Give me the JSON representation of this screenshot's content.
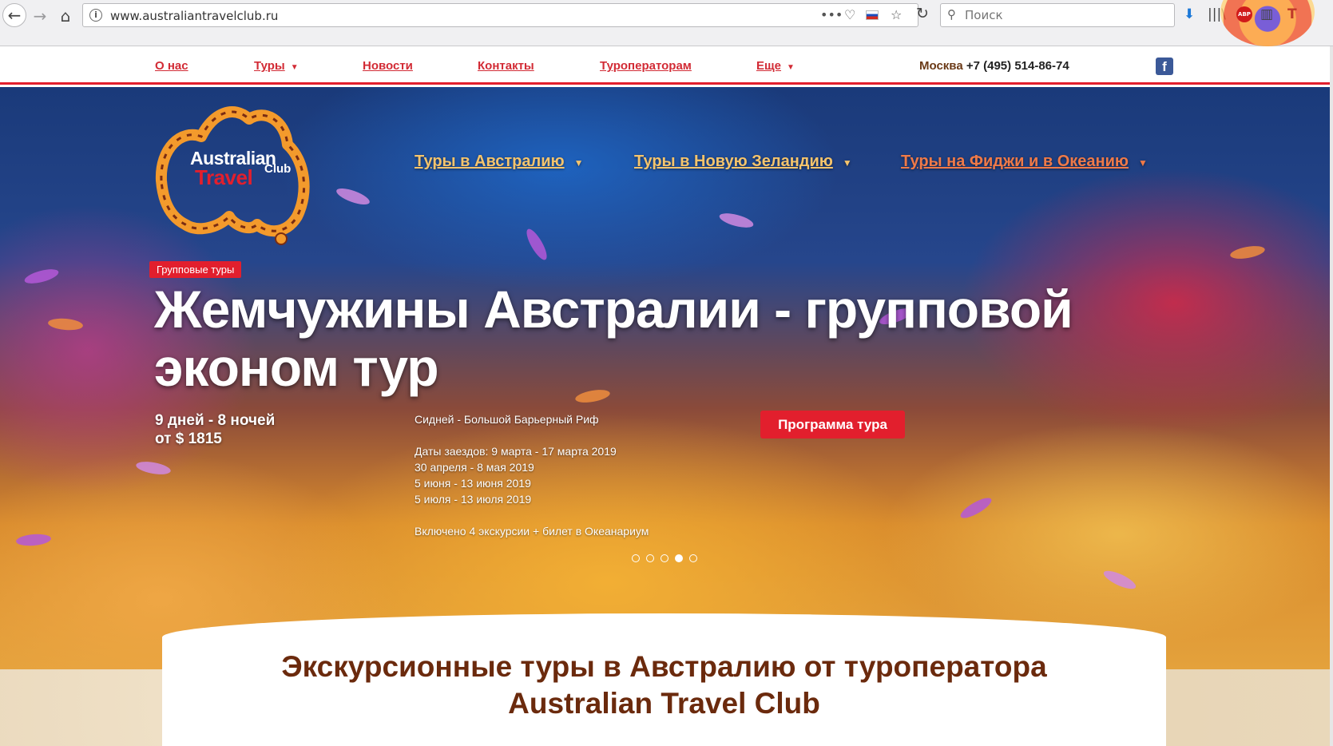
{
  "browser": {
    "url": "www.australiantravelclub.ru",
    "search_placeholder": "Поиск",
    "menu_dots": "•••",
    "abp_label": "ABP"
  },
  "topnav": {
    "items": [
      "О нас",
      "Туры",
      "Новости",
      "Контакты",
      "Туроператорам",
      "Еще"
    ],
    "phone_city": "Москва",
    "phone_number": "+7 (495) 514-86-74",
    "facebook": "f"
  },
  "logo": {
    "line1": "Australian",
    "line2": "Travel",
    "line3": "Club"
  },
  "hero_nav": {
    "items": [
      "Туры в Австралию",
      "Туры в Новую Зеландию",
      "Туры на Фиджи и в Океанию"
    ]
  },
  "slide": {
    "badge": "Групповые туры",
    "title": "Жемчужины Австралии - групповой эконом тур",
    "duration": "9 дней - 8 ночей",
    "price": "от $ 1815",
    "route": "Сидней - Большой Барьерный Риф",
    "dates": [
      "Даты заездов: 9 марта - 17 марта 2019",
      "30 апреля - 8 мая 2019",
      "5 июня - 13 июня 2019",
      "5 июля - 13 июля 2019"
    ],
    "included": "Включено 4 экскурсии + билет в Океанариум",
    "button": "Программа тура",
    "active_dot": 4,
    "dot_count": 5
  },
  "intro": {
    "title_line1": "Экскурсионные туры в Австралию от туроператора",
    "title_line2": "Australian Travel Club"
  },
  "colors": {
    "accent_red": "#e21f2d",
    "nav_red": "#d22b35",
    "brown": "#6b2a0d",
    "gold": "#f5c46c"
  }
}
